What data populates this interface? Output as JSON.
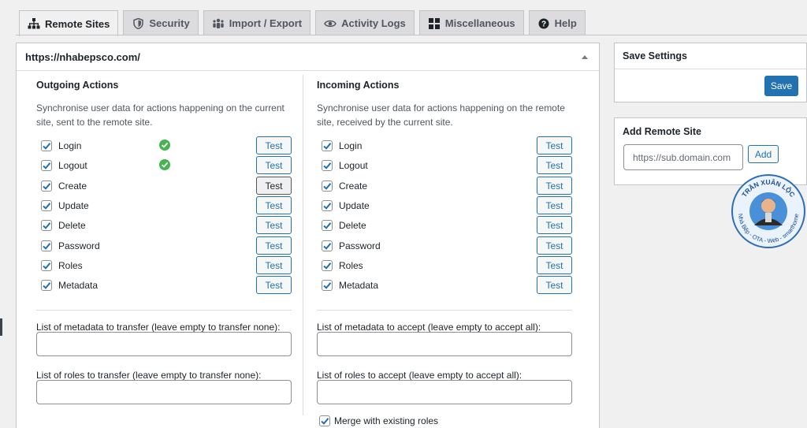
{
  "tabs": [
    {
      "label": "Remote Sites",
      "icon": "sitemap-icon",
      "active": true
    },
    {
      "label": "Security",
      "icon": "shield-icon",
      "active": false
    },
    {
      "label": "Import / Export",
      "icon": "users-group-icon",
      "active": false
    },
    {
      "label": "Activity Logs",
      "icon": "eye-icon",
      "active": false
    },
    {
      "label": "Miscellaneous",
      "icon": "grid-icon",
      "active": false
    },
    {
      "label": "Help",
      "icon": "question-icon",
      "active": false
    }
  ],
  "site": {
    "url": "https://nhabepsco.com/",
    "outgoing": {
      "title": "Outgoing Actions",
      "description": "Synchronise user data for actions happening on the current site, sent to the remote site.",
      "actions": [
        {
          "label": "Login",
          "checked": true,
          "status_ok": true
        },
        {
          "label": "Logout",
          "checked": true,
          "status_ok": true
        },
        {
          "label": "Create",
          "checked": true,
          "status_ok": false
        },
        {
          "label": "Update",
          "checked": true,
          "status_ok": false
        },
        {
          "label": "Delete",
          "checked": true,
          "status_ok": false
        },
        {
          "label": "Password",
          "checked": true,
          "status_ok": false
        },
        {
          "label": "Roles",
          "checked": true,
          "status_ok": false
        },
        {
          "label": "Metadata",
          "checked": true,
          "status_ok": false
        }
      ],
      "metadata_label": "List of metadata to transfer (leave empty to transfer none):",
      "metadata_value": "",
      "roles_label": "List of roles to transfer (leave empty to transfer none):",
      "roles_value": ""
    },
    "incoming": {
      "title": "Incoming Actions",
      "description": "Synchronise user data for actions happening on the remote site, received by the current site.",
      "actions": [
        {
          "label": "Login",
          "checked": true
        },
        {
          "label": "Logout",
          "checked": true
        },
        {
          "label": "Create",
          "checked": true
        },
        {
          "label": "Update",
          "checked": true
        },
        {
          "label": "Delete",
          "checked": true
        },
        {
          "label": "Password",
          "checked": true
        },
        {
          "label": "Roles",
          "checked": true
        },
        {
          "label": "Metadata",
          "checked": true
        }
      ],
      "metadata_label": "List of metadata to accept (leave empty to accept all):",
      "metadata_value": "",
      "roles_label": "List of roles to accept (leave empty to accept all):",
      "roles_value": "",
      "merge_label": "Merge with existing roles",
      "merge_checked": true
    },
    "test_label": "Test"
  },
  "save_settings": {
    "title": "Save Settings",
    "button": "Save"
  },
  "add_remote": {
    "title": "Add Remote Site",
    "placeholder": "https://sub.domain.com",
    "button": "Add"
  },
  "watermark": {
    "top_text": "TRẦN XUÂN LỘC",
    "bottom_text": "Nhà Bếp - OTA - Web - smarthome"
  },
  "colors": {
    "accent": "#2271b1",
    "success": "#46b450",
    "border": "#c3c4c7"
  }
}
